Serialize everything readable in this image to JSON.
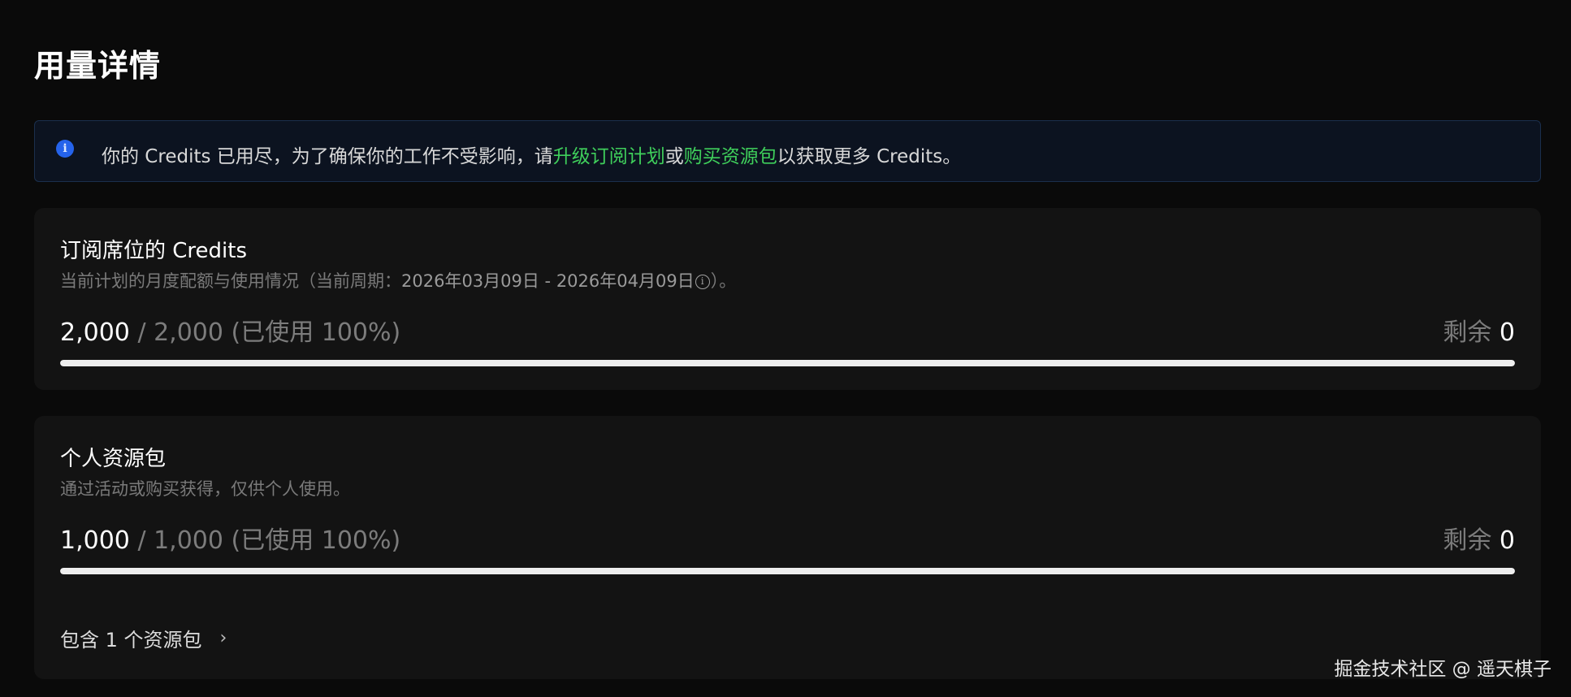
{
  "page": {
    "title": "用量详情"
  },
  "alert": {
    "icon": "info-icon",
    "text_before": "你的 Credits 已用尽，为了确保你的工作不受影响，请",
    "link_upgrade": "升级订阅计划",
    "text_or": "或",
    "link_buy": "购买资源包",
    "text_after": "以获取更多 Credits。",
    "colors": {
      "link": "#3fcf5b",
      "icon_bg": "#2563eb"
    }
  },
  "subscription": {
    "title": "订阅席位的 Credits",
    "subtitle_before": "当前计划的月度配额与使用情况（当前周期：",
    "period": "2026年03月09日 - 2026年04月09日",
    "subtitle_after": "）。",
    "used": "2,000",
    "total": "/ 2,000 (已使用 100%)",
    "remaining_label": "剩余",
    "remaining_value": "0",
    "progress_percent": 100
  },
  "personal": {
    "title": "个人资源包",
    "subtitle": "通过活动或购买获得，仅供个人使用。",
    "used": "1,000",
    "total": "/ 1,000 (已使用 100%)",
    "remaining_label": "剩余",
    "remaining_value": "0",
    "progress_percent": 100,
    "packages_link": "包含 1 个资源包"
  },
  "watermark": "掘金技术社区 @ 遥天棋子"
}
